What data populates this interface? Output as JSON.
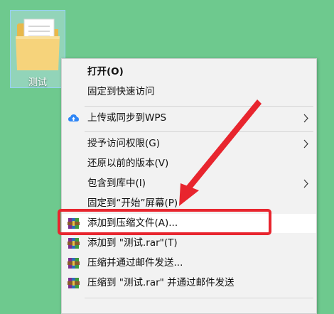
{
  "desktop": {
    "background_color": "#6ec98e",
    "icon": {
      "label": "测试",
      "icon_name": "folder-icon"
    }
  },
  "context_menu": {
    "items": [
      {
        "label": "打开(O)",
        "bold": true,
        "icon": null,
        "submenu": false
      },
      {
        "label": "固定到快速访问",
        "bold": false,
        "icon": null,
        "submenu": false
      },
      {
        "label": "上传或同步到WPS",
        "bold": false,
        "icon": "wps-cloud-upload-icon",
        "submenu": true
      },
      {
        "label": "授予访问权限(G)",
        "bold": false,
        "icon": null,
        "submenu": true
      },
      {
        "label": "还原以前的版本(V)",
        "bold": false,
        "icon": null,
        "submenu": false
      },
      {
        "label": "包含到库中(I)",
        "bold": false,
        "icon": null,
        "submenu": true
      },
      {
        "label": "固定到“开始”屏幕(P)",
        "bold": false,
        "icon": null,
        "submenu": false
      },
      {
        "label": "添加到压缩文件(A)...",
        "bold": false,
        "icon": "winrar-icon",
        "submenu": false,
        "highlighted": true
      },
      {
        "label": "添加到 \"测试.rar\"(T)",
        "bold": false,
        "icon": "winrar-icon",
        "submenu": false
      },
      {
        "label": "压缩并通过邮件发送...",
        "bold": false,
        "icon": "winrar-icon",
        "submenu": false
      },
      {
        "label": "压缩到 \"测试.rar\" 并通过邮件发送",
        "bold": false,
        "icon": "winrar-icon",
        "submenu": false
      }
    ]
  },
  "annotation": {
    "color": "#e8252e",
    "highlight_target": "添加到压缩文件(A)..."
  }
}
